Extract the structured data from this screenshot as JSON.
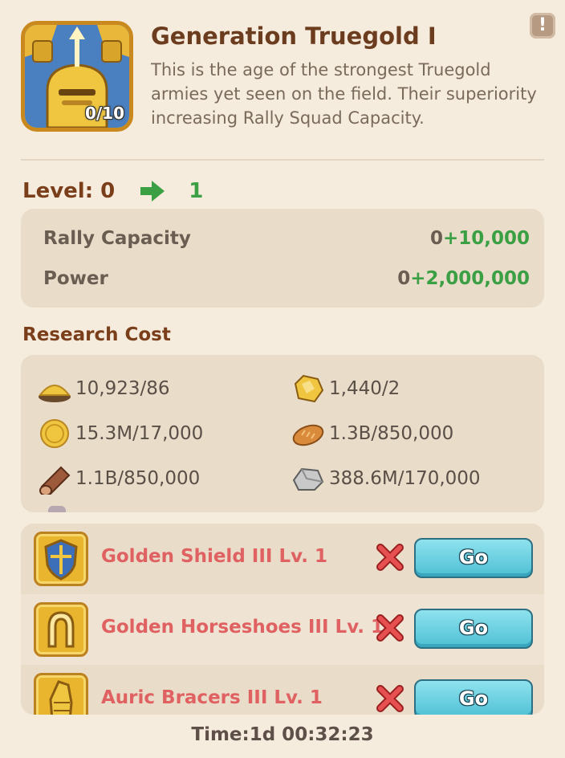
{
  "tech": {
    "title": "Generation Truegold I",
    "description": "This is the age of the strongest Truegold armies yet seen on the field. Their superiority increasing Rally Squad Capacity.",
    "progress": "0/10",
    "info_label": "!"
  },
  "level": {
    "current": "Level: 0",
    "next": "1"
  },
  "stats": [
    {
      "label": "Rally Capacity",
      "base": "0",
      "increase": "+10,000"
    },
    {
      "label": "Power",
      "base": "0",
      "increase": "+2,000,000"
    }
  ],
  "research_cost": {
    "title": "Research Cost",
    "items": [
      {
        "icon": "gold-sand-icon",
        "value": "10,923/86"
      },
      {
        "icon": "gold-nugget-icon",
        "value": "1,440/2"
      },
      {
        "icon": "coin-icon",
        "value": "15.3M/17,000"
      },
      {
        "icon": "bread-icon",
        "value": "1.3B/850,000"
      },
      {
        "icon": "wood-log-icon",
        "value": "1.1B/850,000"
      },
      {
        "icon": "stone-icon",
        "value": "388.6M/170,000"
      }
    ]
  },
  "requirements": [
    {
      "icon": "golden-shield-icon",
      "label": "Golden Shield III  Lv. 1",
      "button": "Go"
    },
    {
      "icon": "golden-horseshoe-icon",
      "label": "Golden Horseshoes III  Lv. 1",
      "button": "Go"
    },
    {
      "icon": "auric-bracers-icon",
      "label": "Auric Bracers III  Lv. 1",
      "button": "Go"
    }
  ],
  "timer": "Time:1d 00:32:23",
  "colors": {
    "background": "#f6ecde",
    "title": "#6c3c1e",
    "increase": "#3aa043",
    "requirement_text": "#e06161",
    "go_button": "#4dc0d4"
  }
}
